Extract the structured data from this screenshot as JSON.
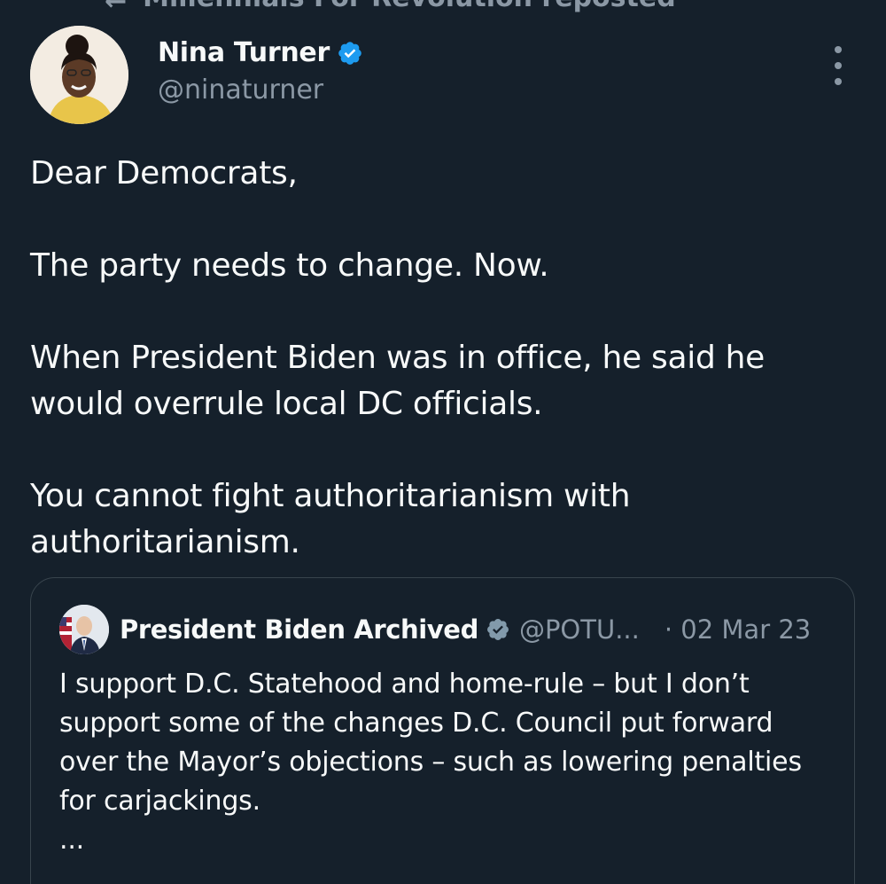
{
  "repost_bar": {
    "text": "Millennials For Revolution reposted"
  },
  "author": {
    "name": "Nina Turner",
    "handle": "@ninaturner"
  },
  "tweet": {
    "paragraphs": [
      "Dear Democrats,",
      "The party needs to change. Now.",
      "When President Biden was in office, he said he would overrule local DC officials.",
      "You cannot fight authoritarianism with authoritarianism."
    ]
  },
  "quote": {
    "name": "President Biden Archived",
    "handle": "@POTU...",
    "date": "· 02 Mar 23",
    "text": "I support D.C. Statehood and home-rule – but I don’t support some of the changes D.C. Council put forward over the Mayor’s objections – such as lowering penalties for carjackings.",
    "ellipsis": "..."
  },
  "colors": {
    "background": "#15202b",
    "text": "#f7f9f9",
    "secondary": "#8b98a5",
    "verified_blue": "#1d9bf0",
    "gray_badge": "#829aab",
    "border": "#38444d"
  },
  "icons": {
    "repost": "repost-icon",
    "verified": "verified-badge-icon",
    "gov_badge": "gray-checkmark-icon",
    "more": "more-options-icon"
  }
}
